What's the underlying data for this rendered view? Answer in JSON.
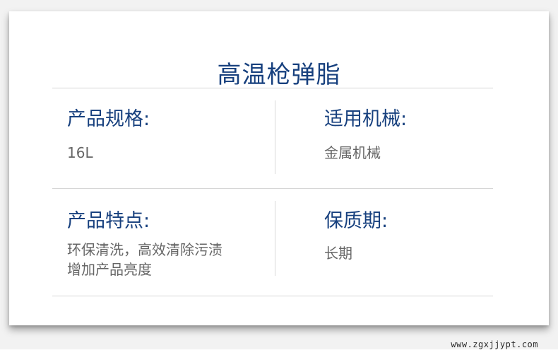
{
  "title": "高温枪弹脂",
  "specs": [
    {
      "label": "产品规格:",
      "value_lines": [
        "16L"
      ]
    },
    {
      "label": "适用机械:",
      "value_lines": [
        "金属机械"
      ]
    },
    {
      "label": "产品特点:",
      "value_lines": [
        "环保清洗，高效清除污渍",
        "增加产品亮度"
      ]
    },
    {
      "label": "保质期:",
      "value_lines": [
        "长期"
      ]
    }
  ],
  "watermark": "www.zgxjjypt.com",
  "colors": {
    "title": "#17407e",
    "label": "#17407e",
    "value": "#666666",
    "divider": "#d6d6d6"
  }
}
